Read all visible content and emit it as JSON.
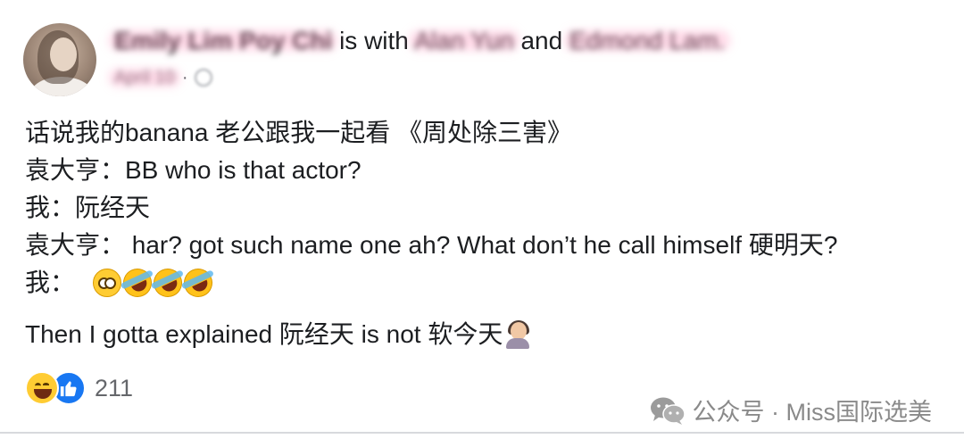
{
  "post": {
    "author": "Emily Lim Poy Chi",
    "with_text": "is with",
    "tagged_1": "Alan Yun",
    "and_text": "and",
    "tagged_2": "Edmond Lam.",
    "date": "April 10",
    "separator": "·",
    "privacy_icon": "globe-icon",
    "lines": [
      "话说我的banana 老公跟我一起看 《周处除三害》",
      "袁大亨：BB who is that actor?",
      "我：阮经天",
      "袁大亨： har?  got such name one ah? What don’t he call himself 硬明天?",
      "我："
    ],
    "reaction_line_emojis": [
      "flushed-face",
      "rolling-on-floor-laughing",
      "rolling-on-floor-laughing",
      "rolling-on-floor-laughing"
    ],
    "closing_line": "Then I gotta explained 阮经天 is not 软今天",
    "closing_emoji": "woman-facepalming"
  },
  "footer": {
    "reaction_icons": [
      "haha-icon",
      "like-icon"
    ],
    "reaction_count": "211",
    "watermark": "公众号 · Miss国际选美",
    "watermark_icon": "wechat-icon"
  },
  "colors": {
    "text": "#1c1e21",
    "secondary": "#65676b",
    "like_blue": "#1877f2",
    "haha_yellow": "#ffcc33"
  }
}
